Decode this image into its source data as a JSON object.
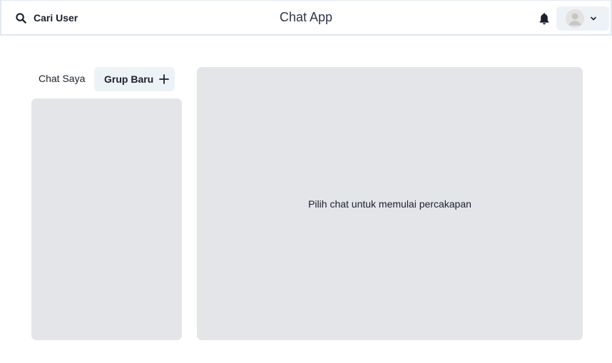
{
  "header": {
    "search_label": "Cari User",
    "title": "Chat App",
    "search_icon": "search-icon",
    "bell_icon": "bell-icon",
    "avatar_icon": "user-avatar-icon",
    "chevron_icon": "chevron-down-icon"
  },
  "tabs": {
    "my_chats": "Chat Saya",
    "new_group": "Grup Baru",
    "new_group_icon": "plus-icon"
  },
  "chat_panel": {
    "placeholder": "Pilih chat untuk memulai percakapan"
  },
  "colors": {
    "panel_bg": "#e4e5e8",
    "button_bg": "#edf2f7",
    "text": "#1a202c"
  }
}
